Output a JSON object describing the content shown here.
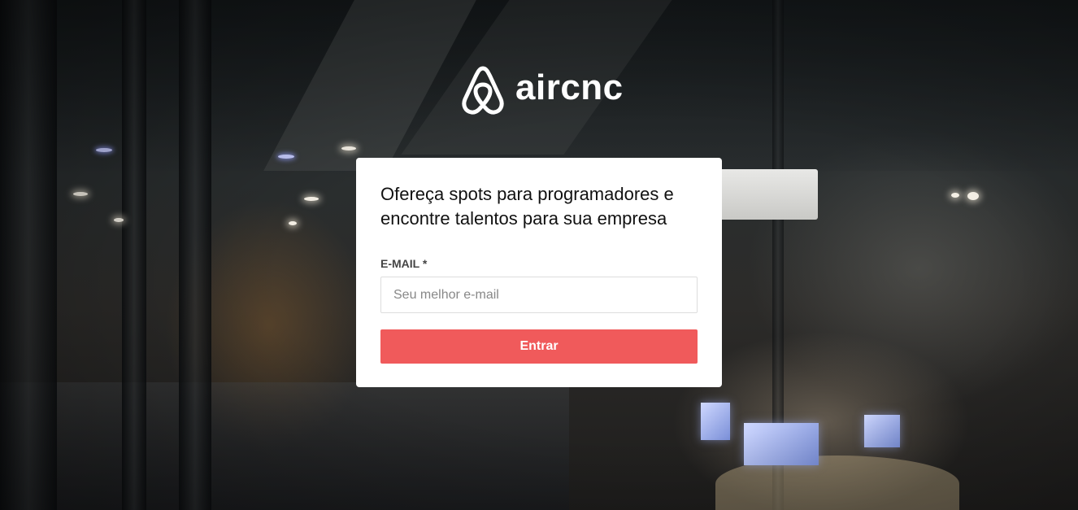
{
  "brand": {
    "name": "aircnc",
    "logo_icon": "airbnb-belo-icon",
    "color": "#ffffff"
  },
  "card": {
    "headline_line1": "Ofereça spots para programadores e",
    "headline_line2": "encontre talentos para sua empresa",
    "email_label": "E-MAIL *",
    "email_value": "",
    "email_placeholder": "Seu melhor e-mail",
    "submit_label": "Entrar"
  },
  "colors": {
    "accent": "#f05a5b",
    "card_background": "#ffffff"
  }
}
